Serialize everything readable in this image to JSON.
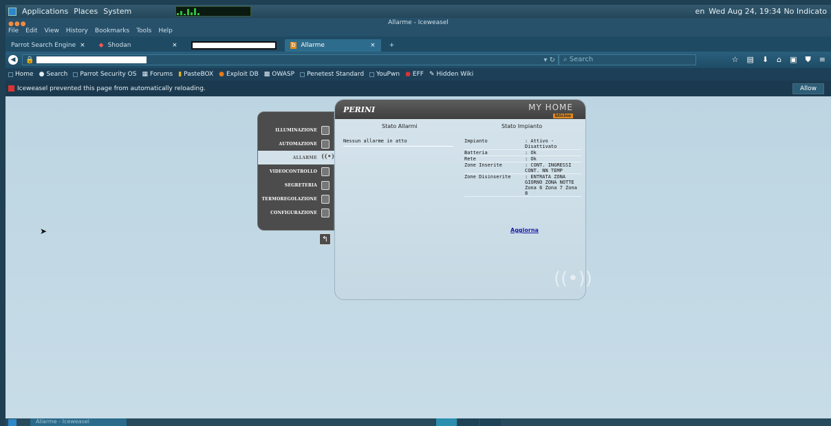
{
  "top_panel": {
    "menus": [
      "Applications",
      "Places",
      "System"
    ],
    "clock": "Wed Aug 24, 19:34",
    "indicator": "No Indicato",
    "lang": "en"
  },
  "browser": {
    "window_title": "Allarme - Iceweasel",
    "menu": [
      "File",
      "Edit",
      "View",
      "History",
      "Bookmarks",
      "Tools",
      "Help"
    ],
    "tabs": [
      {
        "label": "Parrot Search Engine"
      },
      {
        "label": "Shodan"
      },
      {
        "label": ""
      },
      {
        "label": "Allarme"
      }
    ],
    "search_placeholder": "Search",
    "bookmarks": [
      "Home",
      "Search",
      "Parrot Security OS",
      "Forums",
      "PasteBOX",
      "Exploit DB",
      "OWASP",
      "Penetest Standard",
      "YouPwn",
      "EFF",
      "Hidden Wiki"
    ],
    "notification": "Iceweasel prevented this page from automatically reloading.",
    "allow_label": "Allow"
  },
  "app": {
    "brand": "PERINI",
    "logo_text": "MY HOME",
    "logo_sub": "bticino",
    "menu": [
      {
        "label": "ILLUMINAZIONE",
        "icon": "bulb-icon"
      },
      {
        "label": "AUTOMAZIONE",
        "icon": "shutter-icon"
      },
      {
        "label": "ALLARME",
        "icon": "alarm-icon"
      },
      {
        "label": "VIDEOCONTROLLO",
        "icon": "wrench-icon"
      },
      {
        "label": "SEGRETERIA",
        "icon": "phone-icon"
      },
      {
        "label": "TERMOREGOLAZIONE",
        "icon": "thermometer-icon"
      },
      {
        "label": "CONFIGURAZIONE",
        "icon": "gears-icon"
      }
    ],
    "col_alarms": "Stato Allarmi",
    "col_system": "Stato Impianto",
    "alarms_empty": "Nessun allarme in atto",
    "system": [
      {
        "k": "Impianto",
        "v": ": Attivo - Disattivato"
      },
      {
        "k": "Batteria",
        "v": ": Ok"
      },
      {
        "k": "Rete",
        "v": ": Ok"
      },
      {
        "k": "Zone Inserite",
        "v": ": CONT. INGRESSI CONT. NN TEMP"
      },
      {
        "k": "Zone Disinserite",
        "v": ": ENTRATA ZONA GIORNO ZONA NOTTE Zona 6 Zona 7 Zona 8"
      }
    ],
    "refresh_label": "Aggiorna"
  },
  "taskbar": {
    "task_label": "Allarme - Iceweasel"
  },
  "colors": {
    "accent": "#2d87c8",
    "page_bg": "#c3d9e5",
    "panel_dark": "#4c4c4c",
    "link": "#1a1aa5"
  }
}
